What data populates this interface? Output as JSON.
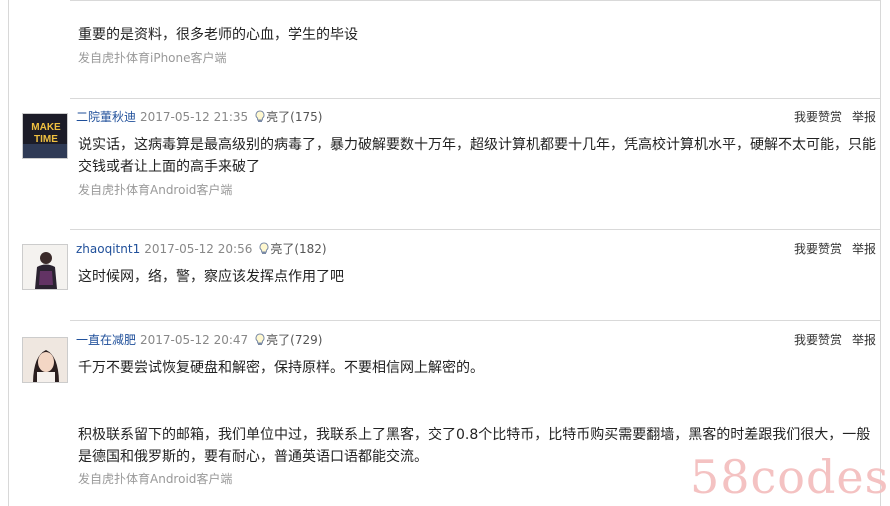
{
  "post0": {
    "content": "重要的是资料，很多老师的心血，学生的毕设",
    "source": "发自虎扑体育iPhone客户端"
  },
  "post1": {
    "username": "二院董秋迪",
    "date": "2017-05-12 21:35",
    "light": "亮了(175)",
    "reward": "我要赞赏",
    "report": "举报",
    "content": "说实话，这病毒算是最高级别的病毒了，暴力破解要数十万年，超级计算机都要十几年，凭高校计算机水平，硬解不太可能，只能交钱或者让上面的高手来破了",
    "source": "发自虎扑体育Android客户端",
    "avatar_text_1": "MAKE",
    "avatar_text_2": "TIME"
  },
  "post2": {
    "username": "zhaoqitnt1",
    "date": "2017-05-12 20:56",
    "light": "亮了(182)",
    "reward": "我要赞赏",
    "report": "举报",
    "content": "这时候网，络，警，察应该发挥点作用了吧"
  },
  "post3": {
    "username": "一直在减肥",
    "date": "2017-05-12 20:47",
    "light": "亮了(729)",
    "reward": "我要赞赏",
    "report": "举报",
    "content_p1": "千万不要尝试恢复硬盘和解密，保持原样。不要相信网上解密的。",
    "content_p2": "积极联系留下的邮箱，我们单位中过，我联系上了黑客，交了0.8个比特币，比特币购买需要翻墙，黑客的时差跟我们很大，一般是德国和俄罗斯的，要有耐心，普通英语口语都能交流。",
    "source": "发自虎扑体育Android客户端"
  },
  "watermark": "58codes",
  "colors": {
    "username": "#1f4f9a",
    "watermark": "#f4c2c2"
  },
  "icons": {
    "light": "lightbulb-icon"
  }
}
